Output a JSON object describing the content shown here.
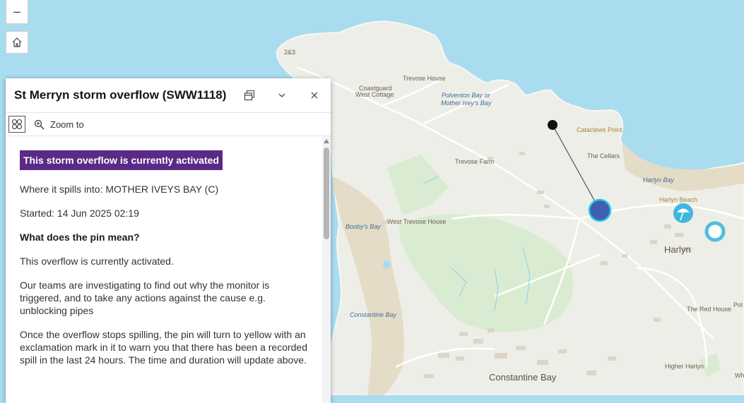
{
  "map": {
    "labels": {
      "l_283": "2&3",
      "coastguard1": "Coastguard",
      "coastguard2": "West Cottage",
      "trevose_house": "Trevose House",
      "polventon1": "Polventon Bay or",
      "polventon2": "Mother Ivey's Bay",
      "cataclews": "Cataclews Point",
      "the_cellars": "The Cellars",
      "trevose_farm": "Trevose Farm",
      "harlyn_bay": "Harlyn Bay",
      "harlyn_beach": "Harlyn Beach",
      "boobys_bay": "Booby's Bay",
      "west_trevose": "West Trevose House",
      "harlyn": "Harlyn",
      "red_house": "The Red House",
      "pol": "Pol",
      "constantine_bay_water": "Constantine Bay",
      "higher_harlyn": "Higher Harlyn",
      "constantine_bay": "Constantine Bay",
      "wh": "Wh"
    }
  },
  "controls": {
    "zoom_out": "–"
  },
  "popup": {
    "title": "St Merryn storm overflow (SWW1118)",
    "zoom_to": "Zoom to",
    "status": "This storm overflow is currently activated",
    "spills_into": "Where it spills into: MOTHER IVEYS BAY (C)",
    "started": "Started: 14 Jun 2025 02:19",
    "question": "What does the pin mean?",
    "para1": "This overflow is currently activated.",
    "para2": "Our teams are investigating to find out why the monitor is triggered, and to take any actions against the cause e.g. unblocking pipes",
    "para3": "Once the overflow stops spilling, the pin will turn to yellow with an exclamation mark in it to warn you that there has been a recorded spill in the last 24 hours. The time and duration will update above."
  }
}
